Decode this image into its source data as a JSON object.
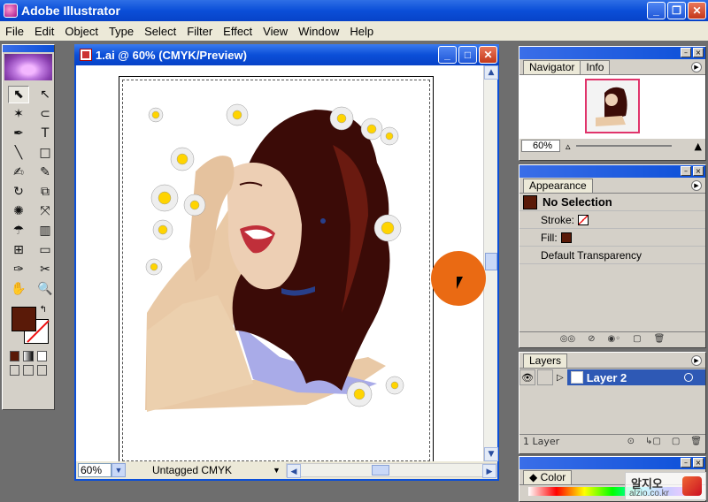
{
  "app": {
    "title": "Adobe Illustrator",
    "window_buttons": [
      "_",
      "❐",
      "✕"
    ]
  },
  "menu": [
    "File",
    "Edit",
    "Object",
    "Type",
    "Select",
    "Filter",
    "Effect",
    "View",
    "Window",
    "Help"
  ],
  "toolbox": {
    "tools": [
      "selection",
      "direct-selection",
      "magic-wand",
      "lasso",
      "pen",
      "type",
      "line",
      "rectangle",
      "paintbrush",
      "pencil",
      "rotate",
      "scale",
      "warp",
      "free-transform",
      "symbol-sprayer",
      "graph",
      "mesh",
      "gradient",
      "eyedropper",
      "scissors",
      "hand",
      "zoom"
    ],
    "tool_glyphs": [
      "⬉",
      "↖",
      "✶",
      "⊂",
      "✒",
      "T",
      "╲",
      "□",
      "✍",
      "✎",
      "↻",
      "⧉",
      "✺",
      "⤧",
      "☂",
      "▥",
      "⊞",
      "▭",
      "✑",
      "✂",
      "✋",
      "🔍"
    ],
    "fill_color": "#5a1a08",
    "stroke": "none"
  },
  "document": {
    "title": "1.ai @ 60% (CMYK/Preview)",
    "zoom": "60%",
    "profile": "Untagged CMYK"
  },
  "navigator": {
    "tabs": [
      "Navigator",
      "Info"
    ],
    "zoom": "60%"
  },
  "appearance": {
    "tab": "Appearance",
    "selection": "No Selection",
    "stroke_label": "Stroke:",
    "fill_label": "Fill:",
    "transparency": "Default Transparency",
    "fill_color": "#5a1a08"
  },
  "layers": {
    "tab": "Layers",
    "layer_name": "Layer 2",
    "count": "1 Layer"
  },
  "color_panel": {
    "tab": "Color"
  },
  "watermark": {
    "top": "알지오",
    "bottom": "alzio.co.kr"
  }
}
